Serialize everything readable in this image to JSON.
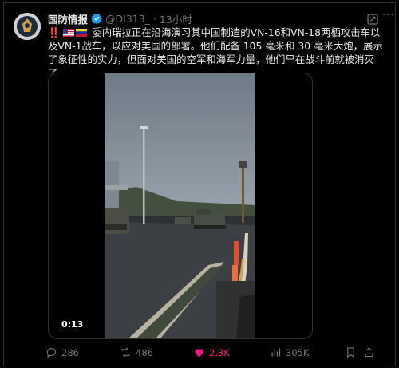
{
  "post": {
    "author_name": "国防情报",
    "handle": "@DI313_",
    "separator": "·",
    "time": "13小时",
    "more": "···",
    "text_prefix": "‼️",
    "text": "委内瑞拉正在沿海演习其中国制造的VN-16和VN-18两栖攻击车以及VN-1战车，以应对美国的部署。他们配备 105 毫米和 30 毫米大炮，展示了象征性的实力，但面对美国的空军和海军力量，他们早在战斗前就被消灭了。"
  },
  "media": {
    "timecode": "0:13"
  },
  "actions": {
    "replies": "286",
    "reposts": "486",
    "likes": "2.3K",
    "views": "305K"
  },
  "colors": {
    "accent": "#1d9bf0",
    "like": "#f91880",
    "muted": "#71767b",
    "background": "#000000"
  },
  "icons": [
    "verified-badge-icon",
    "grok-icon",
    "reply-icon",
    "repost-icon",
    "like-icon",
    "views-icon",
    "bookmark-icon",
    "share-icon"
  ]
}
